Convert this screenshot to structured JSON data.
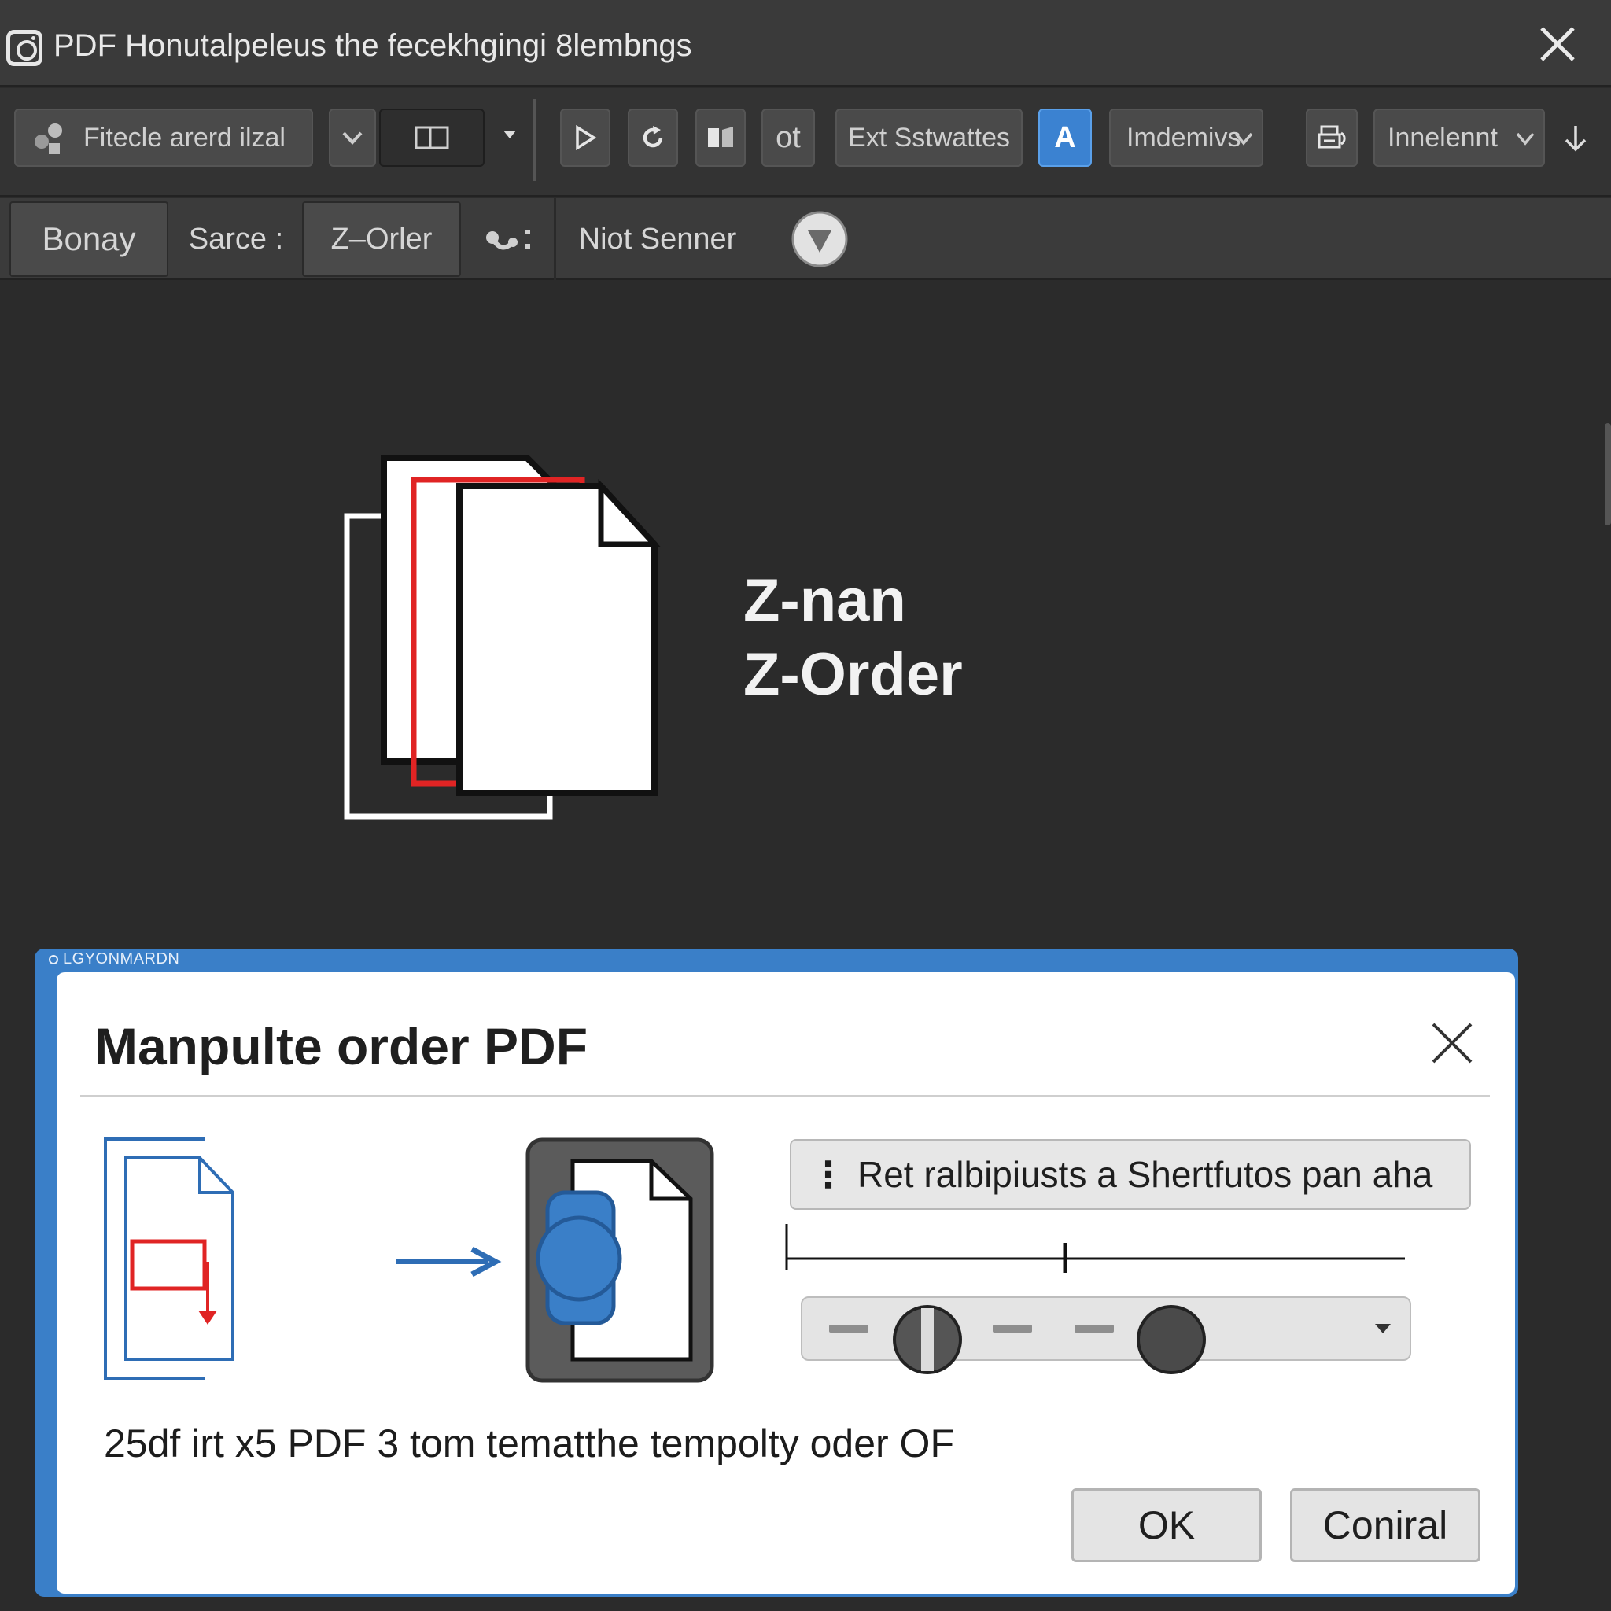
{
  "window": {
    "title": "PDF Honutalpeleus the fecekhgingi 8lembngs"
  },
  "toolbar": {
    "tool_select": "Fitecle arerd ilzal",
    "ot_label": "ot",
    "ext_button": "Ext Sstwattes",
    "a_button": "A",
    "dropdown_1": "Imdemivs",
    "dropdown_2": "Innelennt"
  },
  "subbar": {
    "tab_1": "Bonay",
    "source_label": "Sarce :",
    "zorder_tab": "Z–Orler",
    "mode_label": "Niot Senner"
  },
  "canvas": {
    "line_1": "Z-nan",
    "line_2": "Z-Order",
    "accent_color": "#e02424"
  },
  "dialog": {
    "caption": "LGYONMARDN",
    "title": "Manpulte order PDF",
    "option_text": "Ret ralbipiusts a Shertfutos pan aha",
    "description": "25df irt  x5 PDF 3  tom tematthe tempolty oder OF",
    "ok_label": "OK",
    "cancel_label": "Coniral",
    "accent_color": "#3a7fc8"
  }
}
